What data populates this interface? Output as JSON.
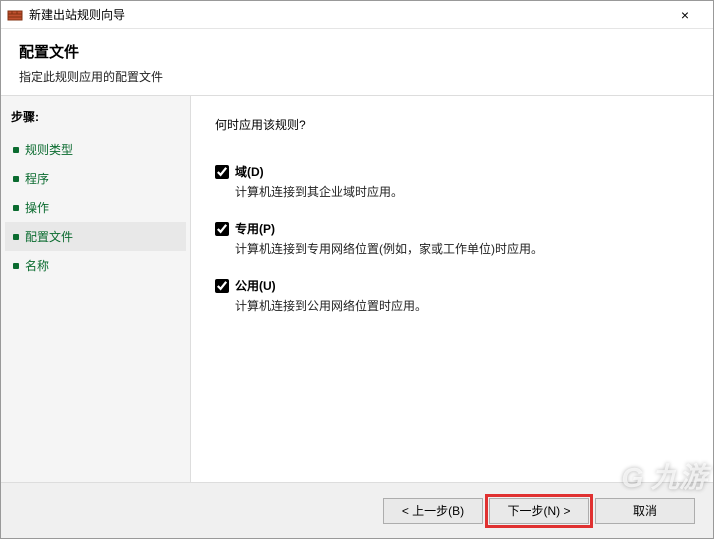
{
  "window": {
    "title": "新建出站规则向导",
    "close_label": "×"
  },
  "header": {
    "title": "配置文件",
    "subtitle": "指定此规则应用的配置文件"
  },
  "sidebar": {
    "steps_title": "步骤:",
    "items": [
      {
        "label": "规则类型",
        "active": false
      },
      {
        "label": "程序",
        "active": false
      },
      {
        "label": "操作",
        "active": false
      },
      {
        "label": "配置文件",
        "active": true
      },
      {
        "label": "名称",
        "active": false
      }
    ]
  },
  "content": {
    "question": "何时应用该规则?",
    "options": [
      {
        "label": "域(D)",
        "desc": "计算机连接到其企业域时应用。",
        "checked": true
      },
      {
        "label": "专用(P)",
        "desc": "计算机连接到专用网络位置(例如，家或工作单位)时应用。",
        "checked": true
      },
      {
        "label": "公用(U)",
        "desc": "计算机连接到公用网络位置时应用。",
        "checked": true
      }
    ]
  },
  "footer": {
    "back": "< 上一步(B)",
    "next": "下一步(N) >",
    "cancel": "取消"
  },
  "watermark": "G 九游"
}
